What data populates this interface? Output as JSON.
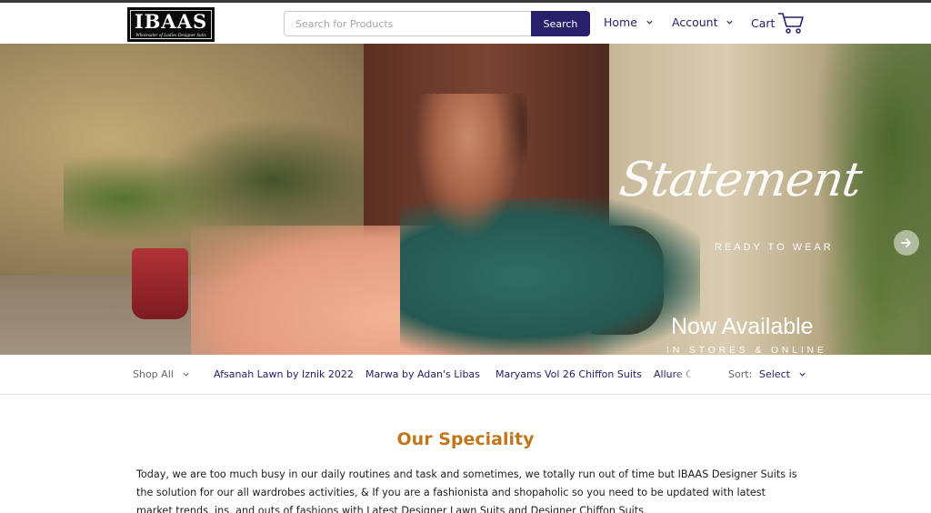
{
  "brand": {
    "logo_text": "IBAAS",
    "logo_tagline": "Wholesaler of Ladies Designer Suits"
  },
  "search": {
    "placeholder": "Search for Products",
    "button_label": "Search"
  },
  "nav": {
    "home_label": "Home",
    "account_label": "Account",
    "cart_label": "Cart"
  },
  "hero": {
    "script_title": "Statement",
    "script_subtitle": "READY TO WEAR",
    "headline": "Now Available",
    "subline": "IN STORES & ONLINE",
    "slide_count": 1,
    "active_slide": 1
  },
  "categories": {
    "shop_all_label": "Shop All",
    "items": [
      "Afsanah Lawn by Iznik 2022",
      "Marwa by Adan's Libas",
      "Maryams Vol 26 Chiffon Suits",
      "Allure C"
    ],
    "sort_label": "Sort:",
    "sort_value": "Select"
  },
  "content": {
    "heading": "Our Speciality",
    "paragraph": " Today, we are too much busy in our daily routines and task and sometimes, we totally run out of time but IBAAS Designer Suits is the solution for our all wardrobes activities, & If you are a fashionista and shopaholic so you need to be updated with latest market trends, ins, and outs of fashions with Latest Designer Lawn Suits and Designer Chiffon Suits."
  },
  "colors": {
    "brand_navy": "#27206b",
    "accent_orange": "#c0761a",
    "logo_bg": "#0b0b0b"
  },
  "icons": [
    "chevron-down-icon",
    "cart-icon",
    "arrow-right-icon"
  ]
}
